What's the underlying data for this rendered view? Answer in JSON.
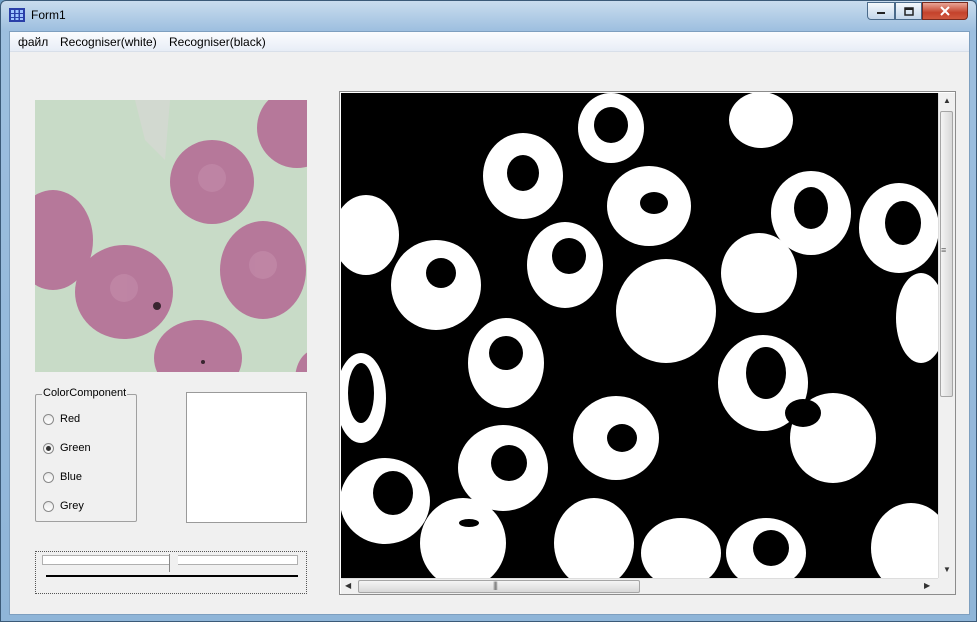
{
  "window": {
    "title": "Form1",
    "app_icon": "app-grid-icon",
    "controls": [
      "minimize-icon",
      "maximize-icon",
      "close-icon"
    ]
  },
  "menu": {
    "items": [
      {
        "label": "файл"
      },
      {
        "label": "Recogniser(white)"
      },
      {
        "label": "Recogniser(black)"
      }
    ]
  },
  "color_component": {
    "title": "ColorComponent",
    "options": [
      {
        "label": "Red",
        "checked": false
      },
      {
        "label": "Green",
        "checked": true
      },
      {
        "label": "Blue",
        "checked": false
      },
      {
        "label": "Grey",
        "checked": false
      }
    ]
  },
  "colors": {
    "thumbnail_bg": "#c9dcc8",
    "cell_fill": "#b77a9e",
    "binary_bg": "#000000",
    "binary_fg": "#ffffff"
  }
}
